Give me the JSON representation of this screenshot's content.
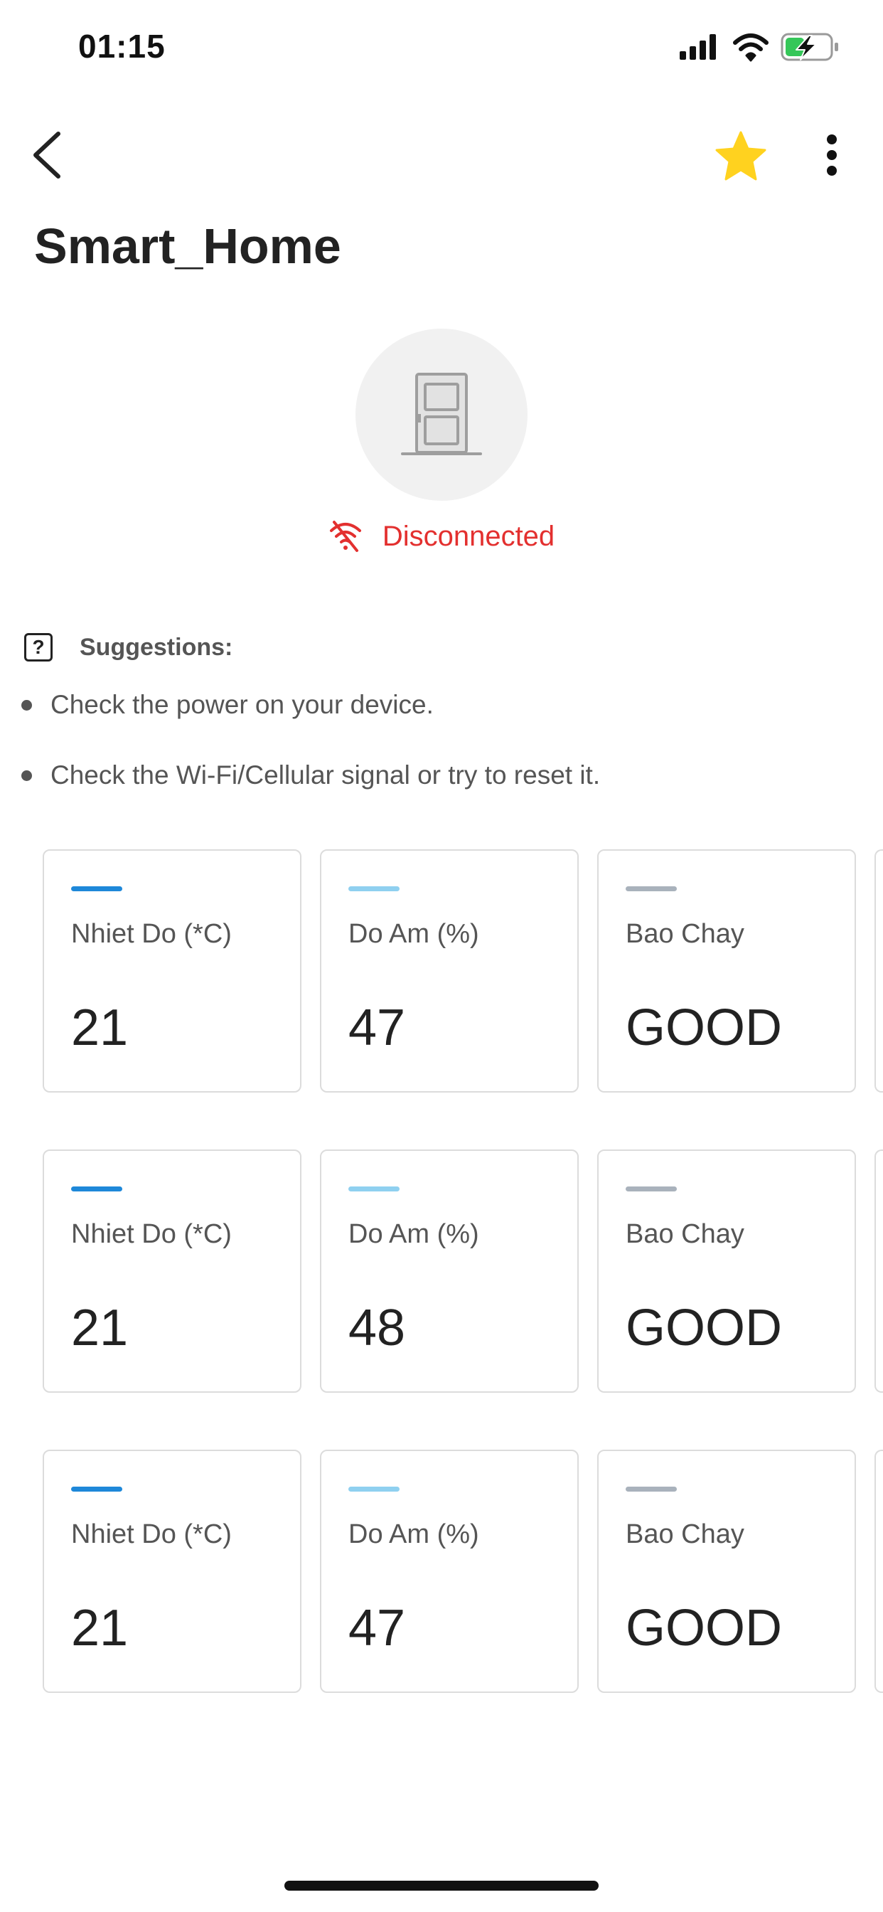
{
  "status_bar": {
    "time": "01:15"
  },
  "nav": {
    "title": "Smart_Home",
    "favorite_color": "#FFD21F"
  },
  "device": {
    "connection_status": "Disconnected",
    "status_color": "#E3302F"
  },
  "suggestions": {
    "title": "Suggestions:",
    "items": [
      "Check the power on your device.",
      "Check the Wi-Fi/Cellular signal or try to reset it."
    ]
  },
  "sensor_rows": [
    [
      {
        "label": "Nhiet Do (*C)",
        "value": "21",
        "color": "#1E88D9"
      },
      {
        "label": "Do Am (%)",
        "value": "47",
        "color": "#8FD0F0"
      },
      {
        "label": "Bao Chay",
        "value": "GOOD",
        "color": "#A9B2BC"
      }
    ],
    [
      {
        "label": "Nhiet Do (*C)",
        "value": "21",
        "color": "#1E88D9"
      },
      {
        "label": "Do Am (%)",
        "value": "48",
        "color": "#8FD0F0"
      },
      {
        "label": "Bao Chay",
        "value": "GOOD",
        "color": "#A9B2BC"
      }
    ],
    [
      {
        "label": "Nhiet Do (*C)",
        "value": "21",
        "color": "#1E88D9"
      },
      {
        "label": "Do Am (%)",
        "value": "47",
        "color": "#8FD0F0"
      },
      {
        "label": "Bao Chay",
        "value": "GOOD",
        "color": "#A9B2BC"
      }
    ]
  ]
}
